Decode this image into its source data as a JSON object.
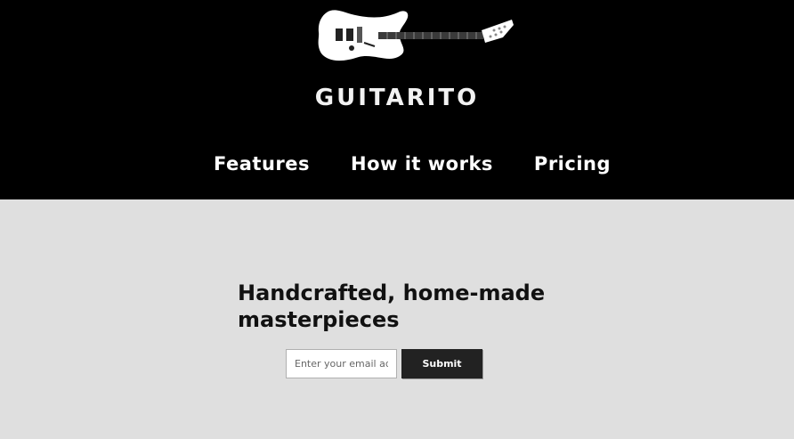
{
  "brand": {
    "name": "GUITARITO",
    "logo_icon": "electric-guitar-icon"
  },
  "nav": {
    "items": [
      {
        "label": "Features"
      },
      {
        "label": "How it works"
      },
      {
        "label": "Pricing"
      }
    ]
  },
  "hero": {
    "headline": "Handcrafted, home-made masterpieces",
    "email_placeholder": "Enter your email address",
    "submit_label": "Submit"
  },
  "colors": {
    "header_bg": "#000000",
    "hero_bg": "#dfdfdf",
    "button_bg": "#222222"
  }
}
